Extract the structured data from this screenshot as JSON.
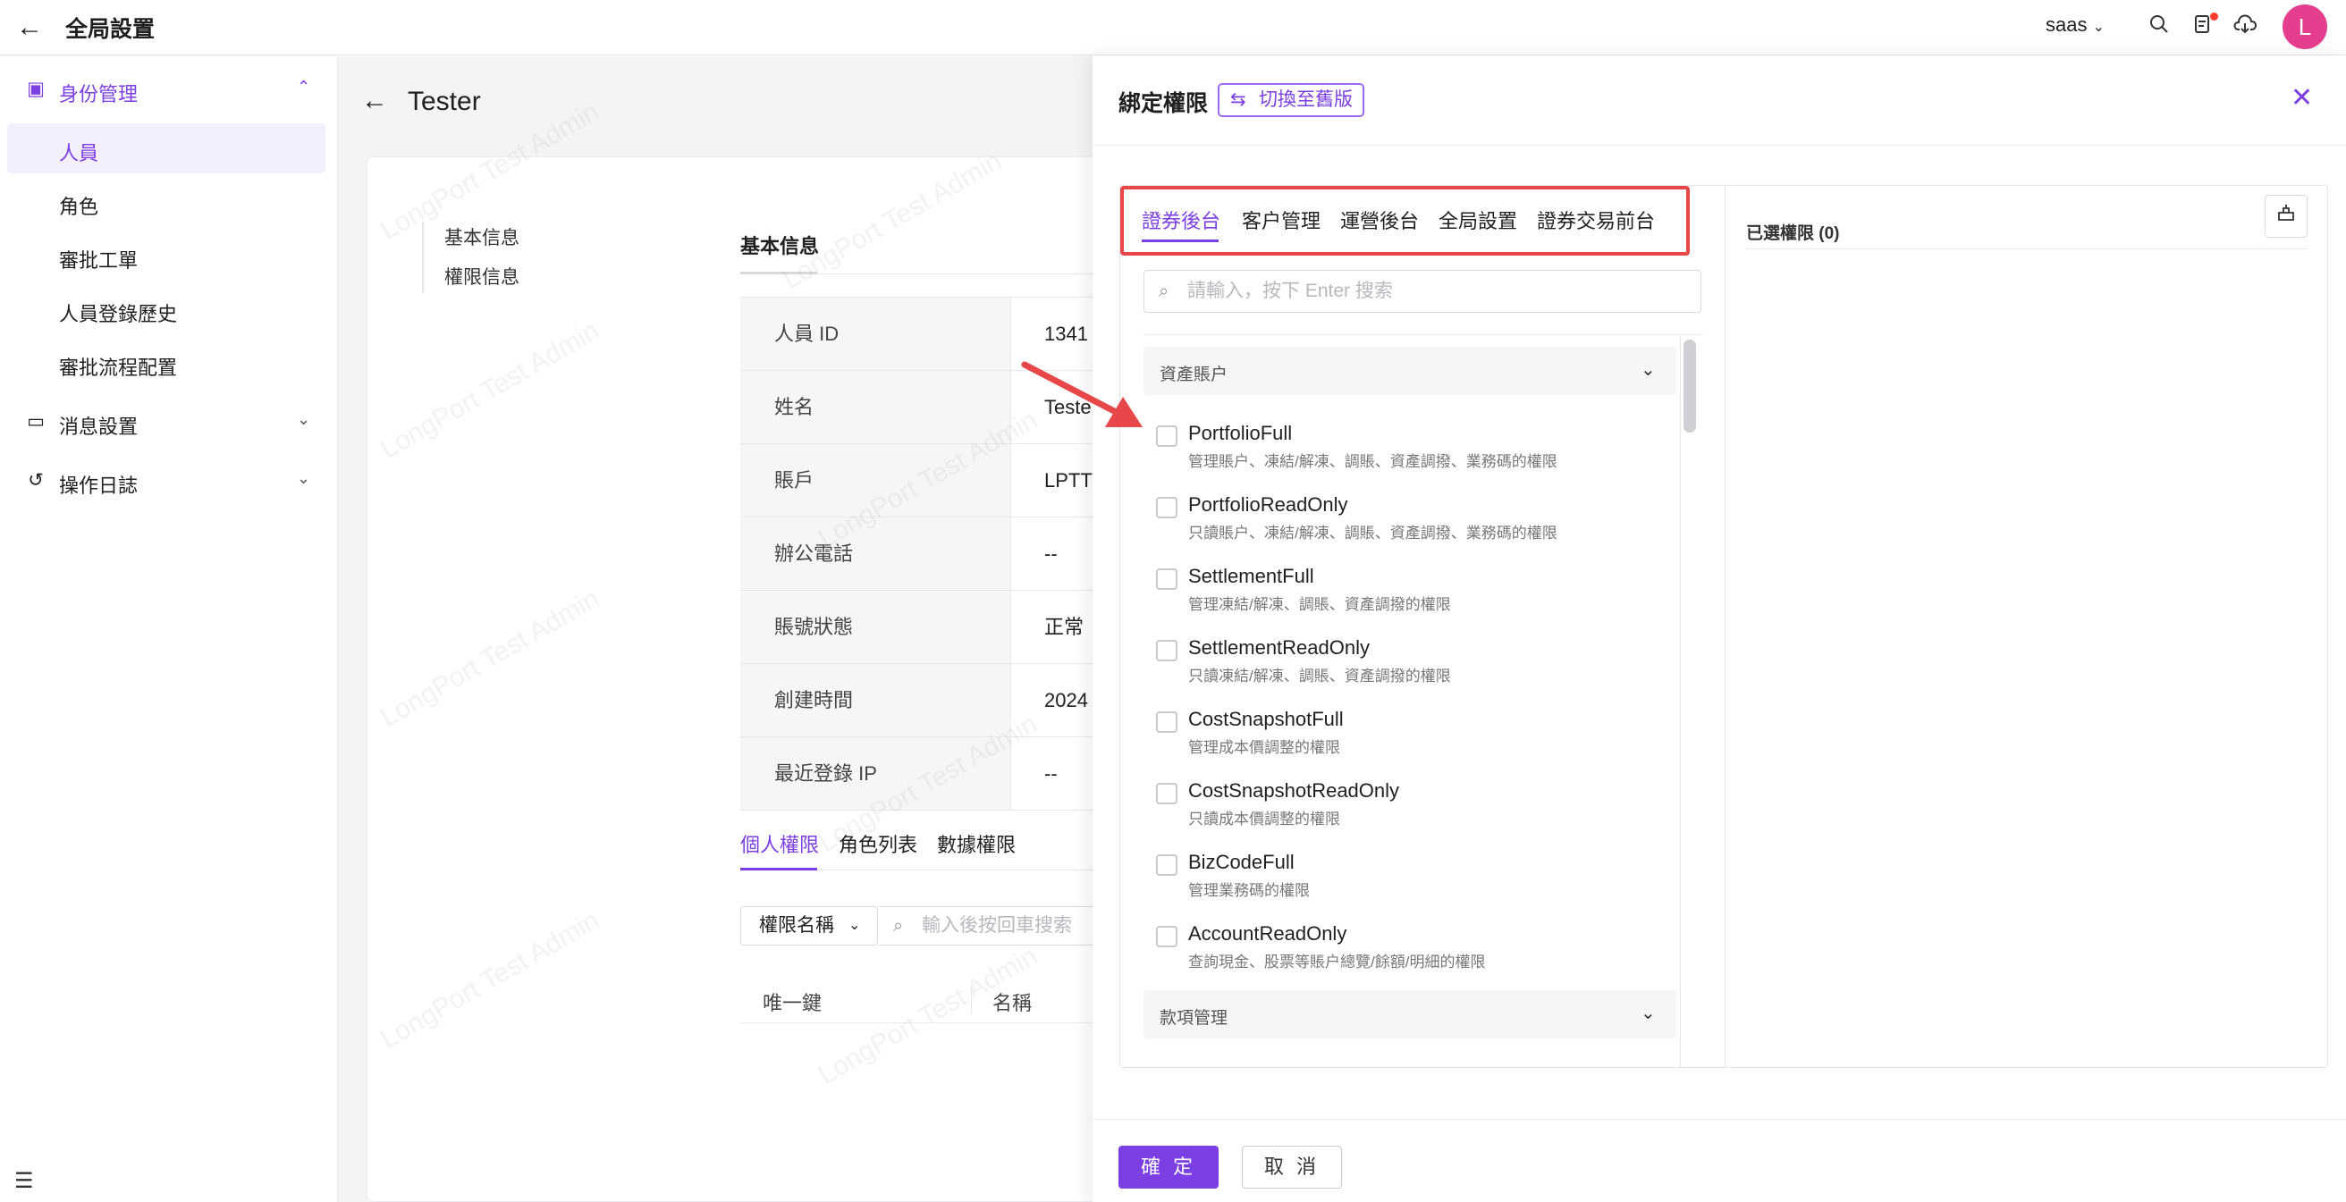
{
  "topbar": {
    "title": "全局設置",
    "tenant": "saas",
    "avatar_initial": "L",
    "icons": [
      "search-icon",
      "notification-icon",
      "download-icon"
    ]
  },
  "sidebar": {
    "groups": [
      {
        "label": "身份管理",
        "icon": "id-card-icon",
        "expanded": true
      },
      {
        "label": "消息設置",
        "icon": "message-icon",
        "expanded": false
      },
      {
        "label": "操作日誌",
        "icon": "history-icon",
        "expanded": false
      }
    ],
    "items": [
      {
        "label": "人員",
        "selected": true
      },
      {
        "label": "角色",
        "selected": false
      },
      {
        "label": "審批工單",
        "selected": false
      },
      {
        "label": "人員登錄歷史",
        "selected": false
      },
      {
        "label": "審批流程配置",
        "selected": false
      }
    ]
  },
  "main": {
    "title": "Tester",
    "anchors": [
      "基本信息",
      "權限信息"
    ],
    "section_tab": "基本信息",
    "info": [
      {
        "key": "人員 ID",
        "value": "1341"
      },
      {
        "key": "姓名",
        "value": "Teste"
      },
      {
        "key": "賬戶",
        "value": "LPTT"
      },
      {
        "key": "辦公電話",
        "value": "--"
      },
      {
        "key": "賬號狀態",
        "value": "正常"
      },
      {
        "key": "創建時間",
        "value": "2024"
      },
      {
        "key": "最近登錄 IP",
        "value": "--"
      }
    ],
    "sub_tabs": [
      "個人權限",
      "角色列表",
      "數據權限"
    ],
    "filter_select": "權限名稱",
    "filter_placeholder": "輸入後按回車搜索",
    "table_headers": [
      "唯一鍵",
      "名稱"
    ],
    "watermark": "LongPort Test Admin"
  },
  "drawer": {
    "title": "綁定權限",
    "switch_label": "切換至舊版",
    "tabs": [
      "證券後台",
      "客户管理",
      "運營後台",
      "全局設置",
      "證券交易前台"
    ],
    "active_tab": "證券後台",
    "search_placeholder": "請輸入，按下 Enter 搜索",
    "groups": [
      "資產賬户",
      "款項管理"
    ],
    "permissions": [
      {
        "name": "PortfolioFull",
        "desc": "管理賬户、凍結/解凍、調賬、資產調撥、業務碼的權限"
      },
      {
        "name": "PortfolioReadOnly",
        "desc": "只讀賬户、凍結/解凍、調賬、資產調撥、業務碼的權限"
      },
      {
        "name": "SettlementFull",
        "desc": "管理凍結/解凍、調賬、資產調撥的權限"
      },
      {
        "name": "SettlementReadOnly",
        "desc": "只讀凍結/解凍、調賬、資產調撥的權限"
      },
      {
        "name": "CostSnapshotFull",
        "desc": "管理成本價調整的權限"
      },
      {
        "name": "CostSnapshotReadOnly",
        "desc": "只讀成本價調整的權限"
      },
      {
        "name": "BizCodeFull",
        "desc": "管理業務碼的權限"
      },
      {
        "name": "AccountReadOnly",
        "desc": "查詢現金、股票等賬户總覽/餘額/明細的權限"
      }
    ],
    "selected_title": "已選權限 (0)",
    "ok_label": "確 定",
    "cancel_label": "取 消"
  },
  "colors": {
    "accent": "#7b3fe4",
    "highlight": "#e8474a",
    "avatar": "#e53e8f"
  }
}
